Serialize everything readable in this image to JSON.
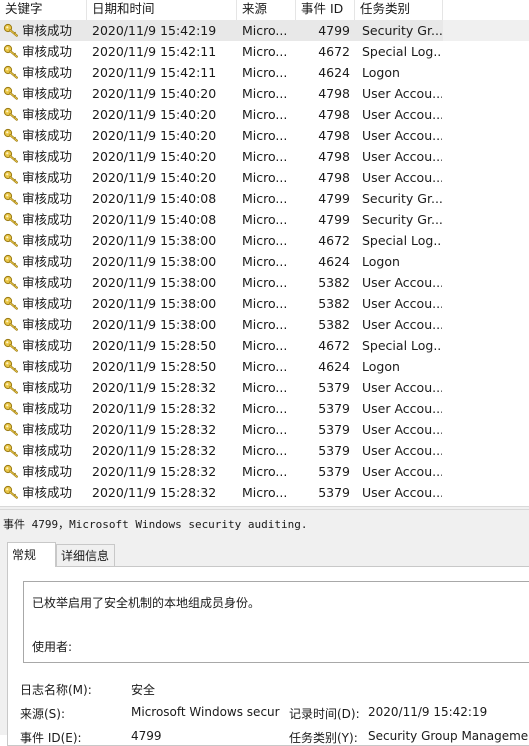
{
  "columns": {
    "keyword": "关键字",
    "datetime": "日期和时间",
    "source": "来源",
    "event_id": "事件 ID",
    "task_category": "任务类别"
  },
  "events": [
    {
      "keyword": "审核成功",
      "datetime": "2020/11/9 15:42:19",
      "source": "Micro...",
      "event_id": "4799",
      "task": "Security Gr..."
    },
    {
      "keyword": "审核成功",
      "datetime": "2020/11/9 15:42:11",
      "source": "Micro...",
      "event_id": "4672",
      "task": "Special Log..."
    },
    {
      "keyword": "审核成功",
      "datetime": "2020/11/9 15:42:11",
      "source": "Micro...",
      "event_id": "4624",
      "task": "Logon"
    },
    {
      "keyword": "审核成功",
      "datetime": "2020/11/9 15:40:20",
      "source": "Micro...",
      "event_id": "4798",
      "task": "User Accou..."
    },
    {
      "keyword": "审核成功",
      "datetime": "2020/11/9 15:40:20",
      "source": "Micro...",
      "event_id": "4798",
      "task": "User Accou..."
    },
    {
      "keyword": "审核成功",
      "datetime": "2020/11/9 15:40:20",
      "source": "Micro...",
      "event_id": "4798",
      "task": "User Accou..."
    },
    {
      "keyword": "审核成功",
      "datetime": "2020/11/9 15:40:20",
      "source": "Micro...",
      "event_id": "4798",
      "task": "User Accou..."
    },
    {
      "keyword": "审核成功",
      "datetime": "2020/11/9 15:40:20",
      "source": "Micro...",
      "event_id": "4798",
      "task": "User Accou..."
    },
    {
      "keyword": "审核成功",
      "datetime": "2020/11/9 15:40:08",
      "source": "Micro...",
      "event_id": "4799",
      "task": "Security Gr..."
    },
    {
      "keyword": "审核成功",
      "datetime": "2020/11/9 15:40:08",
      "source": "Micro...",
      "event_id": "4799",
      "task": "Security Gr..."
    },
    {
      "keyword": "审核成功",
      "datetime": "2020/11/9 15:38:00",
      "source": "Micro...",
      "event_id": "4672",
      "task": "Special Log..."
    },
    {
      "keyword": "审核成功",
      "datetime": "2020/11/9 15:38:00",
      "source": "Micro...",
      "event_id": "4624",
      "task": "Logon"
    },
    {
      "keyword": "审核成功",
      "datetime": "2020/11/9 15:38:00",
      "source": "Micro...",
      "event_id": "5382",
      "task": "User Accou..."
    },
    {
      "keyword": "审核成功",
      "datetime": "2020/11/9 15:38:00",
      "source": "Micro...",
      "event_id": "5382",
      "task": "User Accou..."
    },
    {
      "keyword": "审核成功",
      "datetime": "2020/11/9 15:38:00",
      "source": "Micro...",
      "event_id": "5382",
      "task": "User Accou..."
    },
    {
      "keyword": "审核成功",
      "datetime": "2020/11/9 15:28:50",
      "source": "Micro...",
      "event_id": "4672",
      "task": "Special Log..."
    },
    {
      "keyword": "审核成功",
      "datetime": "2020/11/9 15:28:50",
      "source": "Micro...",
      "event_id": "4624",
      "task": "Logon"
    },
    {
      "keyword": "审核成功",
      "datetime": "2020/11/9 15:28:32",
      "source": "Micro...",
      "event_id": "5379",
      "task": "User Accou..."
    },
    {
      "keyword": "审核成功",
      "datetime": "2020/11/9 15:28:32",
      "source": "Micro...",
      "event_id": "5379",
      "task": "User Accou..."
    },
    {
      "keyword": "审核成功",
      "datetime": "2020/11/9 15:28:32",
      "source": "Micro...",
      "event_id": "5379",
      "task": "User Accou..."
    },
    {
      "keyword": "审核成功",
      "datetime": "2020/11/9 15:28:32",
      "source": "Micro...",
      "event_id": "5379",
      "task": "User Accou..."
    },
    {
      "keyword": "审核成功",
      "datetime": "2020/11/9 15:28:32",
      "source": "Micro...",
      "event_id": "5379",
      "task": "User Accou..."
    },
    {
      "keyword": "审核成功",
      "datetime": "2020/11/9 15:28:32",
      "source": "Micro...",
      "event_id": "5379",
      "task": "User Accou..."
    }
  ],
  "row_icon": "key-icon",
  "detail": {
    "title": "事件 4799，Microsoft Windows security auditing.",
    "tabs": [
      "常规",
      "详细信息"
    ],
    "description": "已枚举启用了安全机制的本地组成员身份。",
    "used_by_label": "使用者:",
    "fields": {
      "log_name_label": "日志名称(M):",
      "log_name_value": "安全",
      "source_label": "来源(S):",
      "source_value": "Microsoft Windows secur",
      "logged_label": "记录时间(D):",
      "logged_value": "2020/11/9 15:42:19",
      "event_id_label": "事件 ID(E):",
      "event_id_value": "4799",
      "task_label": "任务类别(Y):",
      "task_value": "Security Group Management"
    }
  }
}
